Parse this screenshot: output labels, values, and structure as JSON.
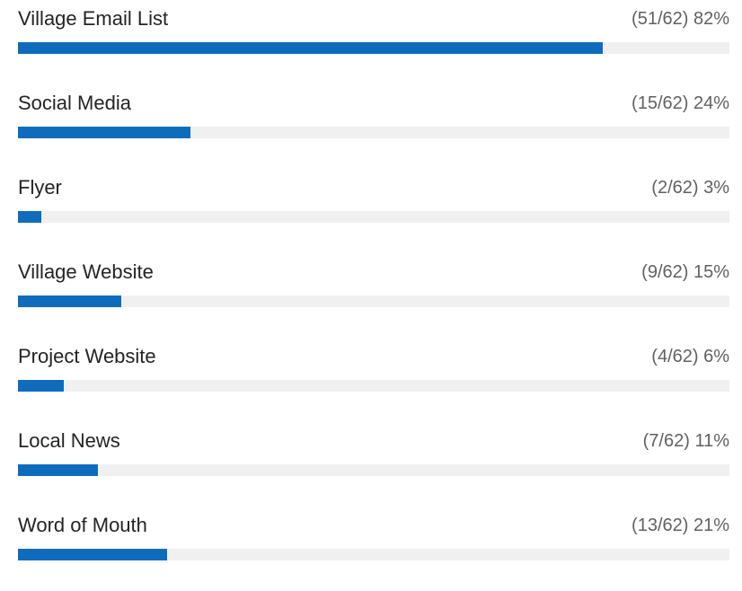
{
  "poll": {
    "total": 62,
    "bar_color": "#0f6cbd",
    "track_color": "#f0f0f0",
    "options": [
      {
        "label": "Village Email List",
        "stat": "(51/62) 82%",
        "count": 51,
        "percent": 82
      },
      {
        "label": "Social Media",
        "stat": "(15/62) 24%",
        "count": 15,
        "percent": 24
      },
      {
        "label": "Flyer",
        "stat": "(2/62) 3%",
        "count": 2,
        "percent": 3
      },
      {
        "label": "Village Website",
        "stat": "(9/62) 15%",
        "count": 9,
        "percent": 15
      },
      {
        "label": "Project Website",
        "stat": "(4/62) 6%",
        "count": 4,
        "percent": 6
      },
      {
        "label": "Local News",
        "stat": "(7/62) 11%",
        "count": 7,
        "percent": 11
      },
      {
        "label": "Word of Mouth",
        "stat": "(13/62) 21%",
        "count": 13,
        "percent": 21
      }
    ]
  }
}
